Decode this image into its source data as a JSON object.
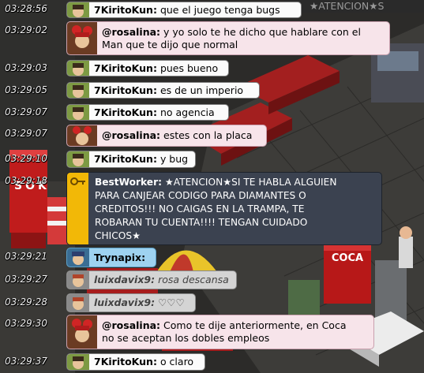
{
  "room": {
    "banner_text": "★ATENCION★S",
    "sign_left": "SOK",
    "sign_right": "COCA"
  },
  "messages": [
    {
      "time": "03:28:56",
      "user": "7KiritoKun:",
      "text": "que el juego tenga bugs",
      "style": "white"
    },
    {
      "time": "03:29:02",
      "user": "@rosalina:",
      "text": "y yo solo te he dicho que hablare con el",
      "text2": "Man que te dijo que normal",
      "style": "pink"
    },
    {
      "time": "03:29:03",
      "user": "7KiritoKun:",
      "text": "pues bueno",
      "style": "white"
    },
    {
      "time": "03:29:05",
      "user": "7KiritoKun:",
      "text": "es de un imperio",
      "style": "white"
    },
    {
      "time": "03:29:07",
      "user": "7KiritoKun:",
      "text": "no agencia",
      "style": "white"
    },
    {
      "time": "03:29:07",
      "user": "@rosalina:",
      "text": "estes con la placa",
      "style": "pink"
    },
    {
      "time": "03:29:10",
      "user": "7KiritoKun:",
      "text": "y bug",
      "style": "white"
    },
    {
      "time": "03:29:18",
      "user": "BestWorker:",
      "text": "★ATENCION★SI TE HABLA ALGUIEN",
      "text2": "PARA CANJEAR CODIGO PARA DIAMANTES O",
      "text3": "CREDITOS!!! NO CAIGAS EN LA TRAMPA, TE",
      "text4": "ROBARAN TU CUENTA!!!! TENGAN CUIDADO",
      "text5": "CHICOS★",
      "style": "dark"
    },
    {
      "time": "03:29:21",
      "user": "Trynapix:",
      "text": "",
      "style": "blue"
    },
    {
      "time": "03:29:27",
      "user": "luixdavix9:",
      "text": "rosa descansa",
      "style": "gray"
    },
    {
      "time": "03:29:28",
      "user": "luixdavix9:",
      "text": "♡♡♡",
      "style": "gray"
    },
    {
      "time": "03:29:30",
      "user": "@rosalina:",
      "text": "Como te dije anteriormente, en Coca",
      "text2": "no se aceptan los dobles empleos",
      "style": "pink"
    },
    {
      "time": "03:29:37",
      "user": "7KiritoKun:",
      "text": "o claro",
      "style": "white"
    }
  ]
}
